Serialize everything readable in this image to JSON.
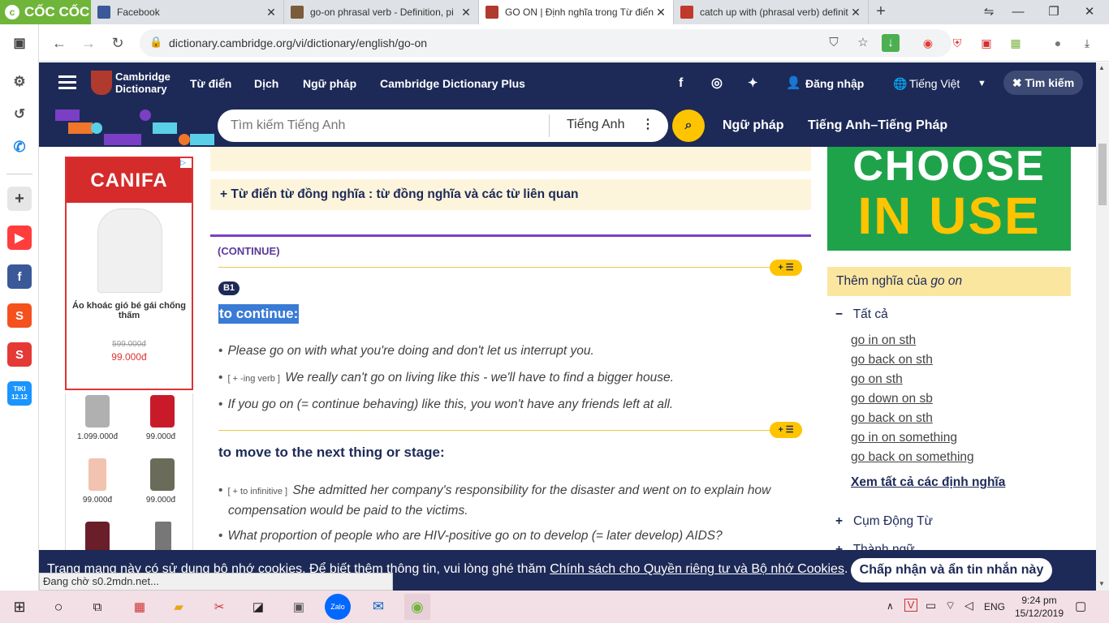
{
  "browser": {
    "logo_text": "CỐC CỐC",
    "tabs": [
      {
        "title": "Facebook",
        "fav_color": "#3b5998"
      },
      {
        "title": "go-on phrasal verb - Definition, pi",
        "fav_color": "#7a5c3a"
      },
      {
        "title": "GO ON | Định nghĩa trong Từ điển",
        "fav_color": "#b03a2e"
      },
      {
        "title": "catch up with (phrasal verb) definit",
        "fav_color": "#c0392b"
      }
    ],
    "url": "dictionary.cambridge.org/vi/dictionary/english/go-on"
  },
  "header": {
    "logo_line1": "Cambridge",
    "logo_line2": "Dictionary",
    "nav": [
      "Từ điển",
      "Dịch",
      "Ngữ pháp",
      "Cambridge Dictionary Plus"
    ],
    "login": "Đăng nhập",
    "language": "Tiếng Việt",
    "close_search": "Tìm kiếm"
  },
  "searchbar": {
    "placeholder": "Tìm kiếm Tiếng Anh",
    "dict": "Tiếng Anh",
    "links": [
      "Ngữ pháp",
      "Tiếng Anh–Tiếng Pháp"
    ]
  },
  "ad": {
    "brand": "CANIFA",
    "product": "Áo khoác gió bé gái chống thấm",
    "old_price": "599.000đ",
    "price": "99.000đ",
    "items": [
      "1.099.000đ",
      "99.000đ",
      "99.000đ",
      "99.000đ"
    ]
  },
  "content": {
    "synonyms": "Từ điển từ đồng nghĩa : từ đồng nghĩa và các từ liên quan",
    "section": "(CONTINUE)",
    "level": "B1",
    "def1": "to continue:",
    "ex1": "Please go on with what you're doing and don't let us interrupt you.",
    "ex2_gram": "[ + -ing verb ]",
    "ex2": "We really can't go on living like this - we'll have to find a bigger house.",
    "ex3": "If you go on (= continue behaving) like this, you won't have any friends left at all.",
    "def2": "to move to the next thing or stage:",
    "ex4_gram": "[ + to infinitive ]",
    "ex4": "She admitted her company's responsibility for the disaster and went on to explain how compensation would be paid to the victims.",
    "ex5": "What proportion of people who are HIV-positive go on to develop (= later develop) AIDS?"
  },
  "sidebar": {
    "banner_top": "CHOOSE",
    "banner_bottom": "IN USE",
    "more_meanings": "Thêm nghĩa của",
    "more_word": "go on",
    "all": "Tất cả",
    "links": [
      "go in on sth",
      "go back on sth",
      "go on sth",
      "go down on sb",
      "go back on sth",
      "go in on something",
      "go back on something"
    ],
    "see_all": "Xem tất cả các định nghĩa",
    "phrasal": "Cụm Động Từ",
    "idioms": "Thành ngữ"
  },
  "cookie": {
    "text": "Trang mạng này có sử dụng bộ nhớ cookies. Để biết thêm thông tin, vui lòng ghé thăm",
    "link": "Chính sách cho Quyền riêng tư và Bộ nhớ Cookies",
    "button": "Chấp nhận và ẩn tin nhắn này"
  },
  "status": "Đang chờ s0.2mdn.net...",
  "taskbar": {
    "lang": "ENG",
    "time": "9:24 pm",
    "date": "15/12/2019",
    "tiki": "TIKI 12.12"
  }
}
